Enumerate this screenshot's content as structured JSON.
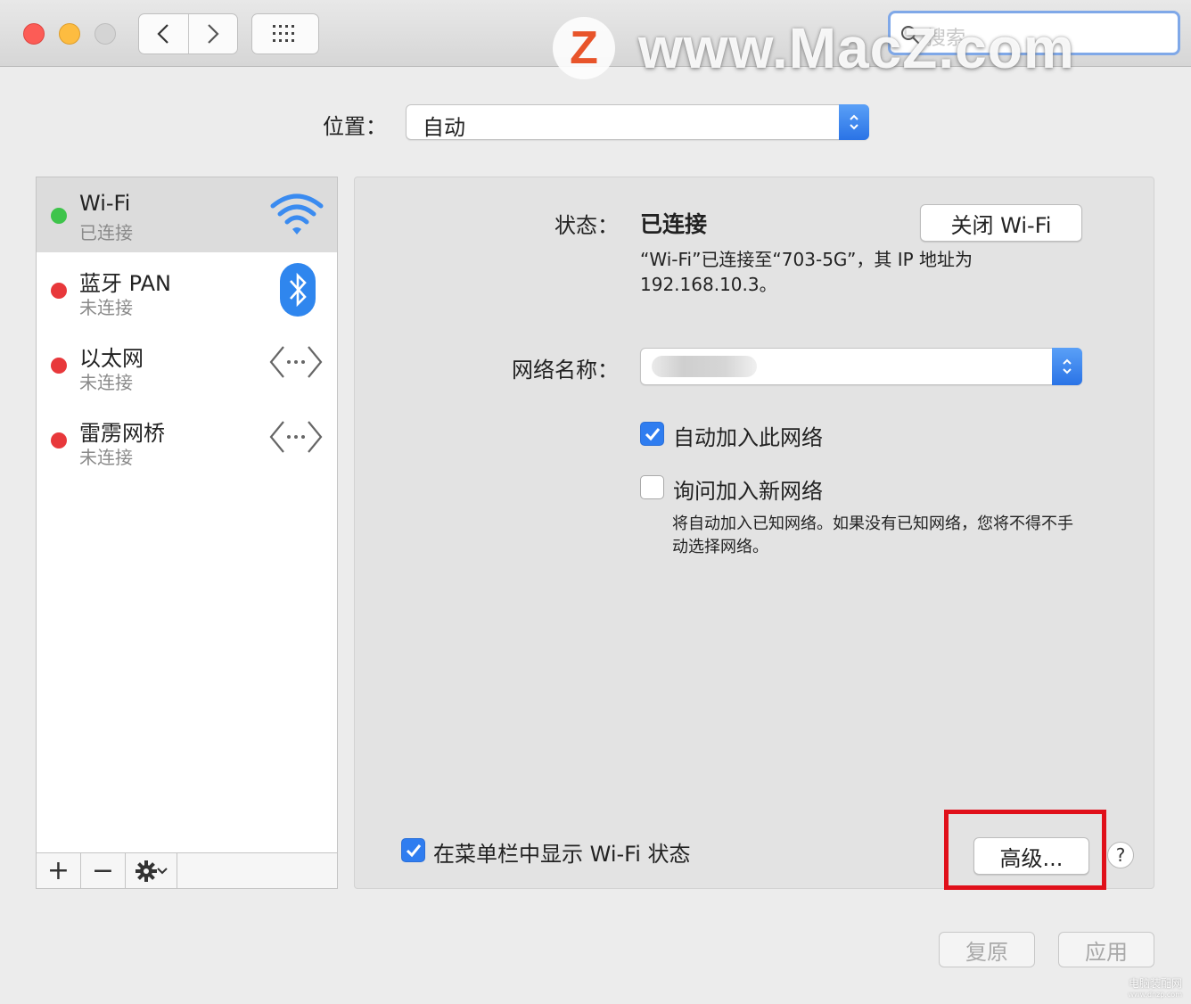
{
  "window": {
    "search_placeholder": "搜索",
    "watermark_text": "www.MacZ.com",
    "watermark_logo_letter": "Z"
  },
  "location": {
    "label": "位置：",
    "value": "自动"
  },
  "services": [
    {
      "name": "Wi-Fi",
      "status": "已连接",
      "status_color": "#3ec44b",
      "icon": "wifi-icon",
      "selected": true
    },
    {
      "name": "蓝牙 PAN",
      "status": "未连接",
      "status_color": "#e8383b",
      "icon": "bluetooth-icon",
      "selected": false
    },
    {
      "name": "以太网",
      "status": "未连接",
      "status_color": "#e8383b",
      "icon": "ethernet-icon",
      "selected": false
    },
    {
      "name": "雷雳网桥",
      "status": "未连接",
      "status_color": "#e8383b",
      "icon": "thunderbolt-bridge-icon",
      "selected": false
    }
  ],
  "sidebar_tools": {
    "add": "+",
    "remove": "−"
  },
  "detail": {
    "status_label": "状态：",
    "status_value": "已连接",
    "wifi_off_button": "关闭 Wi-Fi",
    "status_description": "“Wi-Fi”已连接至“703-5G”，其 IP 地址为 192.168.10.3。",
    "network_name_label": "网络名称：",
    "auto_join_label": "自动加入此网络",
    "auto_join_checked": true,
    "ask_join_label": "询问加入新网络",
    "ask_join_checked": false,
    "ask_join_hint": "将自动加入已知网络。如果没有已知网络，您将不得不手动选择网络。",
    "show_in_menubar_label": "在菜单栏中显示 Wi-Fi 状态",
    "show_in_menubar_checked": true,
    "advanced_button": "高级...",
    "help_button": "?"
  },
  "footer": {
    "revert_button": "复原",
    "apply_button": "应用"
  },
  "corner_watermark": "电脑装配网",
  "corner_watermark_url": "www.dnzp.com",
  "colors": {
    "accent": "#2f7df0",
    "highlight": "#e0101a",
    "connected": "#3ec44b",
    "disconnected": "#e8383b"
  }
}
